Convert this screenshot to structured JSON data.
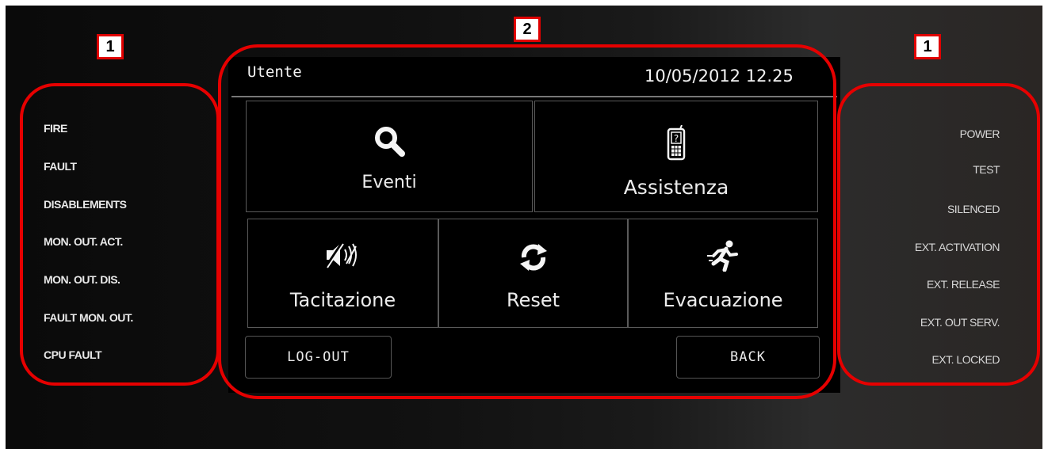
{
  "callouts": {
    "left": "1",
    "center": "2",
    "right": "1"
  },
  "left_leds": [
    "FIRE",
    "FAULT",
    "DISABLEMENTS",
    "MON. OUT. ACT.",
    "MON. OUT. DIS.",
    "FAULT MON. OUT.",
    "CPU FAULT"
  ],
  "right_leds": [
    "POWER",
    "TEST",
    "SILENCED",
    "EXT. ACTIVATION",
    "EXT. RELEASE",
    "EXT. OUT SERV.",
    "EXT. LOCKED"
  ],
  "header": {
    "title": "Utente",
    "datetime": "10/05/2012  12.25"
  },
  "tiles": {
    "eventi": "Eventi",
    "assistenza": "Assistenza",
    "tacitazione": "Tacitazione",
    "reset": "Reset",
    "evacuazione": "Evacuazione"
  },
  "icons": {
    "eventi": "magnifier-icon",
    "assistenza": "help-phone-icon",
    "tacitazione": "muted-speaker-icon",
    "reset": "refresh-icon",
    "evacuazione": "running-person-icon"
  },
  "buttons": {
    "logout": "LOG-OUT",
    "back": "BACK"
  },
  "colors": {
    "annotation": "#e60000",
    "screen": "#000000",
    "text": "#ececec"
  }
}
